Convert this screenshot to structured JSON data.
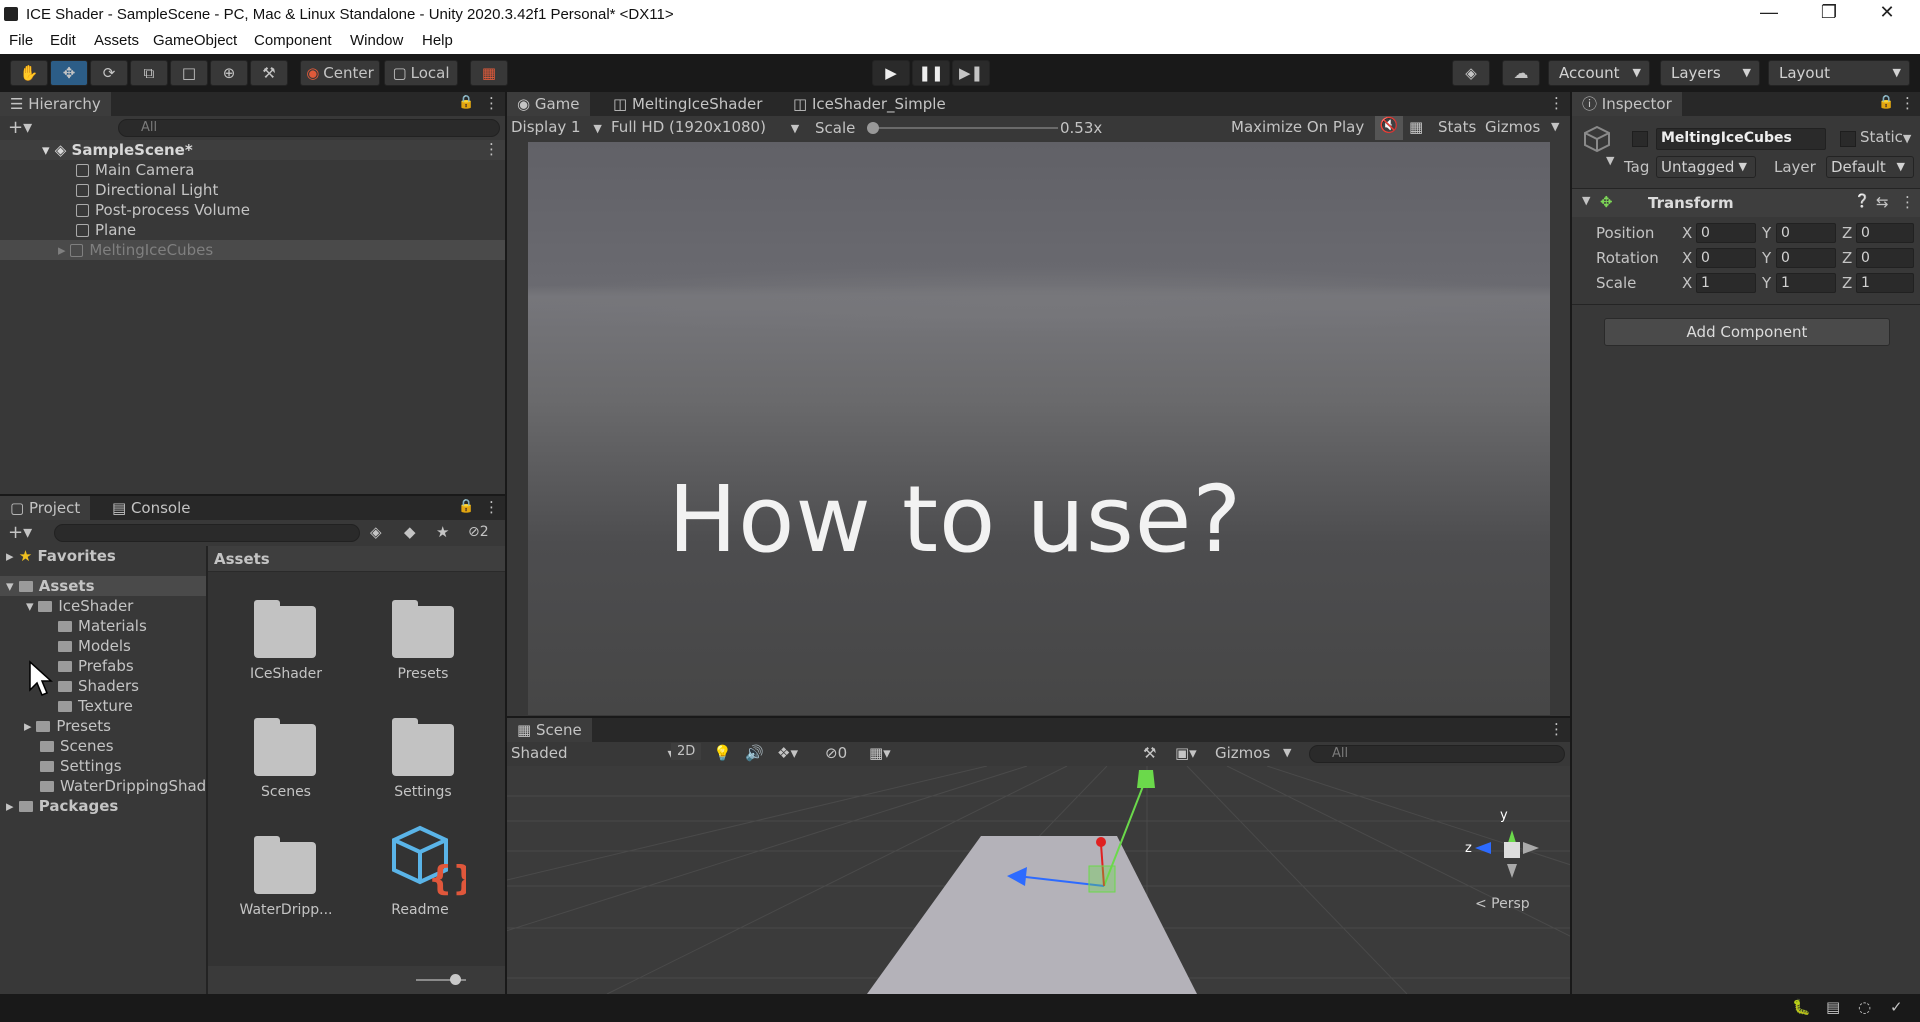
{
  "window": {
    "title": "ICE Shader - SampleScene - PC, Mac & Linux Standalone - Unity 2020.3.42f1 Personal* <DX11>"
  },
  "menu": [
    "File",
    "Edit",
    "Assets",
    "GameObject",
    "Component",
    "Window",
    "Help"
  ],
  "toolbar": {
    "pivot": "Center",
    "space": "Local",
    "account": "Account",
    "layers": "Layers",
    "layout": "Layout"
  },
  "hierarchy": {
    "tab": "Hierarchy",
    "search_placeholder": "All",
    "scene": "SampleScene*",
    "items": [
      "Main Camera",
      "Directional Light",
      "Post-process Volume",
      "Plane",
      "MeltingIceCubes"
    ]
  },
  "game": {
    "tabs": [
      "Game",
      "MeltingIceShader",
      "IceShader_Simple"
    ],
    "display": "Display 1",
    "resolution": "Full HD (1920x1080)",
    "scale_label": "Scale",
    "scale_value": "0.53x",
    "maximize": "Maximize On Play",
    "stats": "Stats",
    "gizmos": "Gizmos",
    "overlay_text": "How to use?"
  },
  "project": {
    "tabs": [
      "Project",
      "Console"
    ],
    "hidden_count": "2",
    "favorites": "Favorites",
    "assets_root": "Assets",
    "tree": [
      {
        "label": "IceShader"
      },
      {
        "label": "Materials"
      },
      {
        "label": "Models"
      },
      {
        "label": "Prefabs"
      },
      {
        "label": "Shaders"
      },
      {
        "label": "Texture"
      },
      {
        "label": "Presets"
      },
      {
        "label": "Scenes"
      },
      {
        "label": "Settings"
      },
      {
        "label": "WaterDrippingShade"
      }
    ],
    "packages": "Packages",
    "grid_title": "Assets",
    "grid": [
      "ICeShader",
      "Presets",
      "Scenes",
      "Settings",
      "WaterDripp...",
      "Readme"
    ]
  },
  "scene": {
    "tab": "Scene",
    "shading": "Shaded",
    "mode_2d": "2D",
    "hidden_count": "0",
    "gizmos": "Gizmos",
    "search_placeholder": "All",
    "persp": "< Persp",
    "axis_y": "y",
    "axis_z": "z"
  },
  "inspector": {
    "tab": "Inspector",
    "object_name": "MeltingIceCubes",
    "static": "Static",
    "tag_label": "Tag",
    "tag": "Untagged",
    "layer_label": "Layer",
    "layer": "Default",
    "component": "Transform",
    "rows": [
      {
        "label": "Position",
        "x": "0",
        "y": "0",
        "z": "0"
      },
      {
        "label": "Rotation",
        "x": "0",
        "y": "0",
        "z": "0"
      },
      {
        "label": "Scale",
        "x": "1",
        "y": "1",
        "z": "1"
      }
    ],
    "axis": [
      "X",
      "Y",
      "Z"
    ],
    "add_component": "Add Component"
  },
  "colors": {
    "accent": "#2c5d87",
    "panel": "#383838",
    "dark": "#191919",
    "play_green": "#6bd94b",
    "arrow_blue": "#2d6bff",
    "arrow_red": "#e02020"
  }
}
